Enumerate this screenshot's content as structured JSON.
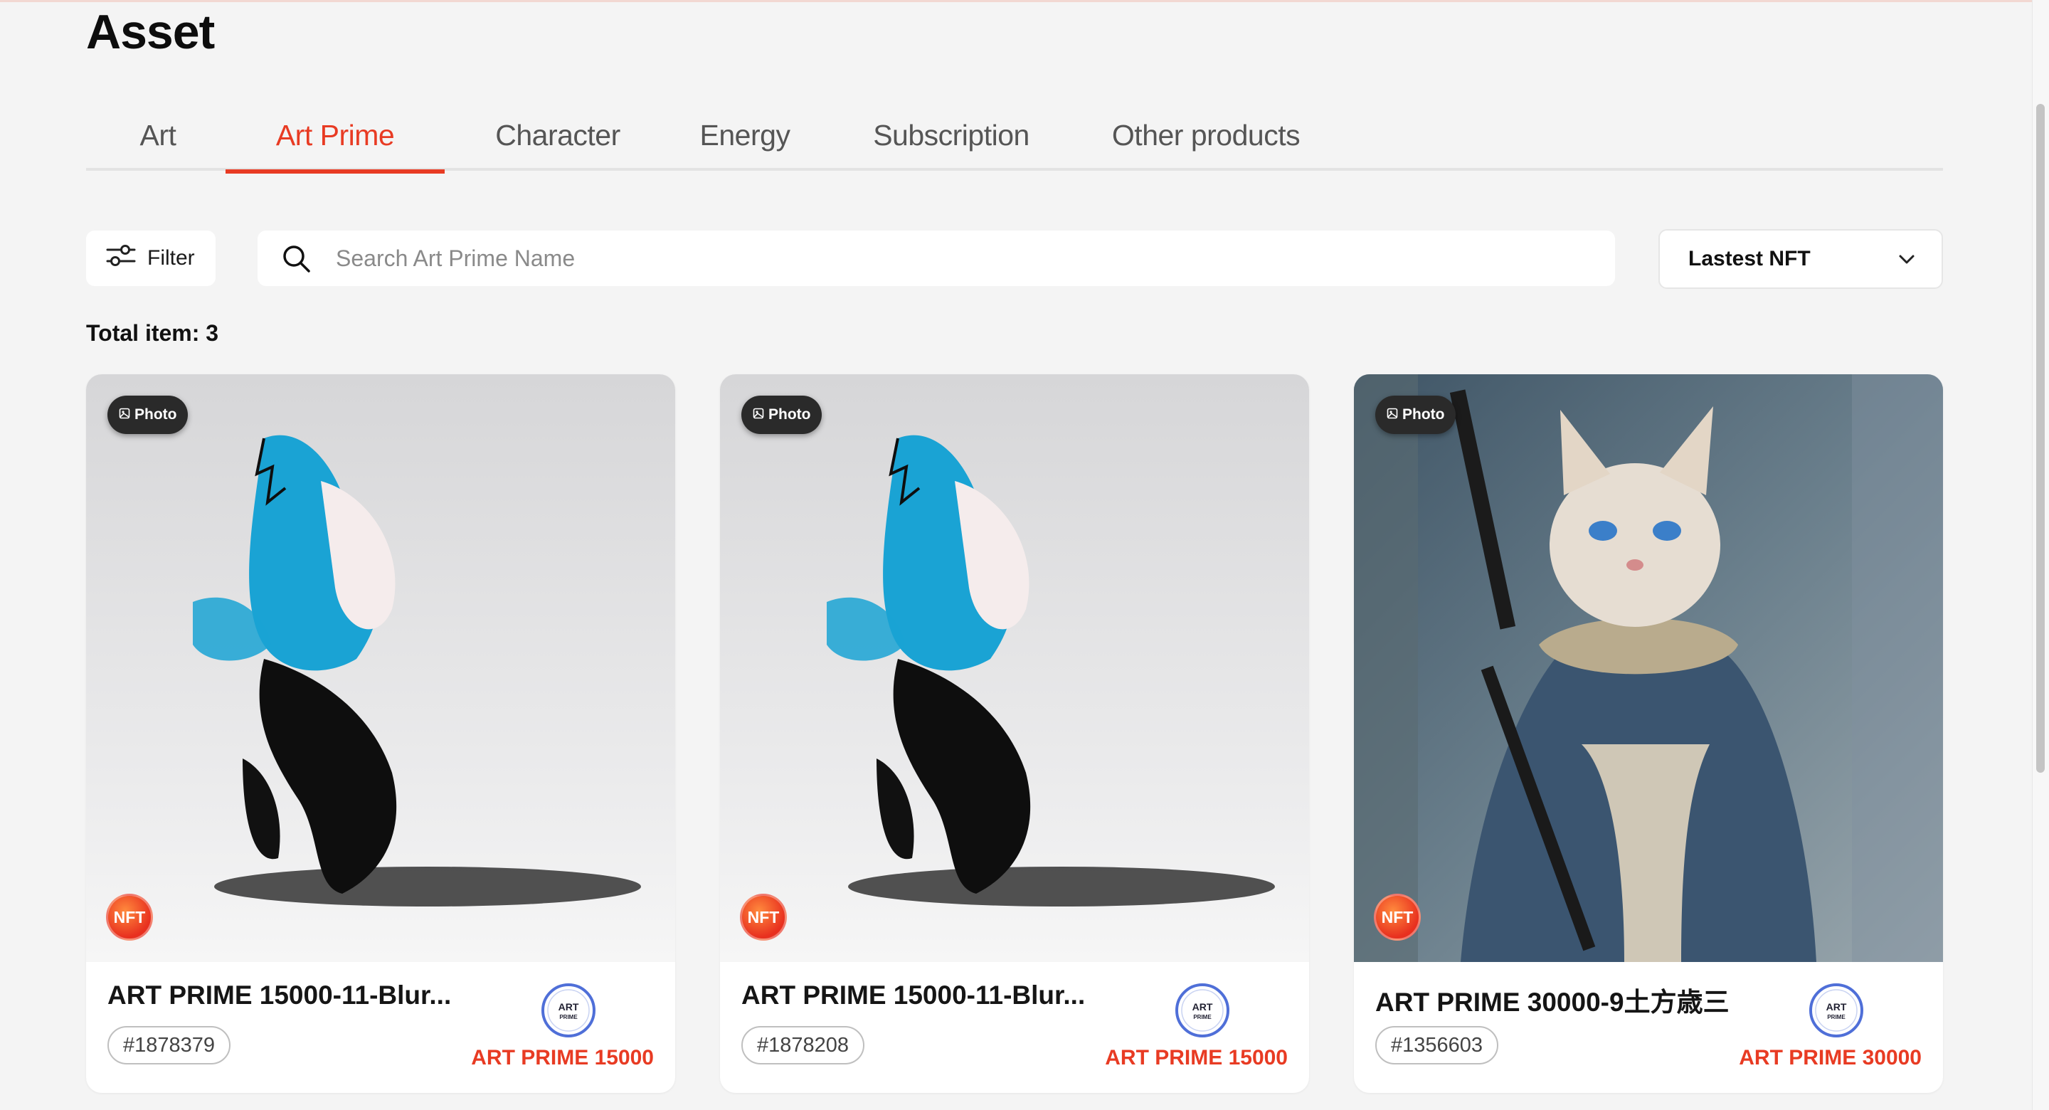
{
  "page": {
    "title": "Asset"
  },
  "tabs": [
    {
      "label": "Art",
      "active": false
    },
    {
      "label": "Art Prime",
      "active": true
    },
    {
      "label": "Character",
      "active": false
    },
    {
      "label": "Energy",
      "active": false
    },
    {
      "label": "Subscription",
      "active": false
    },
    {
      "label": "Other products",
      "active": false
    }
  ],
  "toolbar": {
    "filter_label": "Filter",
    "search_placeholder": "Search Art Prime Name",
    "search_value": "",
    "sort_selected": "Lastest NFT"
  },
  "summary": {
    "total_label": "Total item: 3"
  },
  "cards": [
    {
      "media_type": "Photo",
      "nft_label": "NFT",
      "name": "ART PRIME 15000-11-Blur...",
      "token_id": "#1878379",
      "logo_text": "ART PRIME",
      "collection": "ART PRIME 15000",
      "image": "blue-feather-figure"
    },
    {
      "media_type": "Photo",
      "nft_label": "NFT",
      "name": "ART PRIME 15000-11-Blur...",
      "token_id": "#1878208",
      "logo_text": "ART PRIME",
      "collection": "ART PRIME 15000",
      "image": "blue-feather-figure"
    },
    {
      "media_type": "Photo",
      "nft_label": "NFT",
      "name": "ART PRIME 30000-9土方歳三",
      "token_id": "#1356603",
      "logo_text": "ART PRIME",
      "collection": "ART PRIME 30000",
      "image": "samurai-cat"
    }
  ],
  "colors": {
    "accent": "#e83b23",
    "background": "#f4f4f4",
    "card": "#ffffff"
  },
  "icons": [
    "filter-sliders-icon",
    "search-icon",
    "chevron-down-icon",
    "image-icon"
  ]
}
